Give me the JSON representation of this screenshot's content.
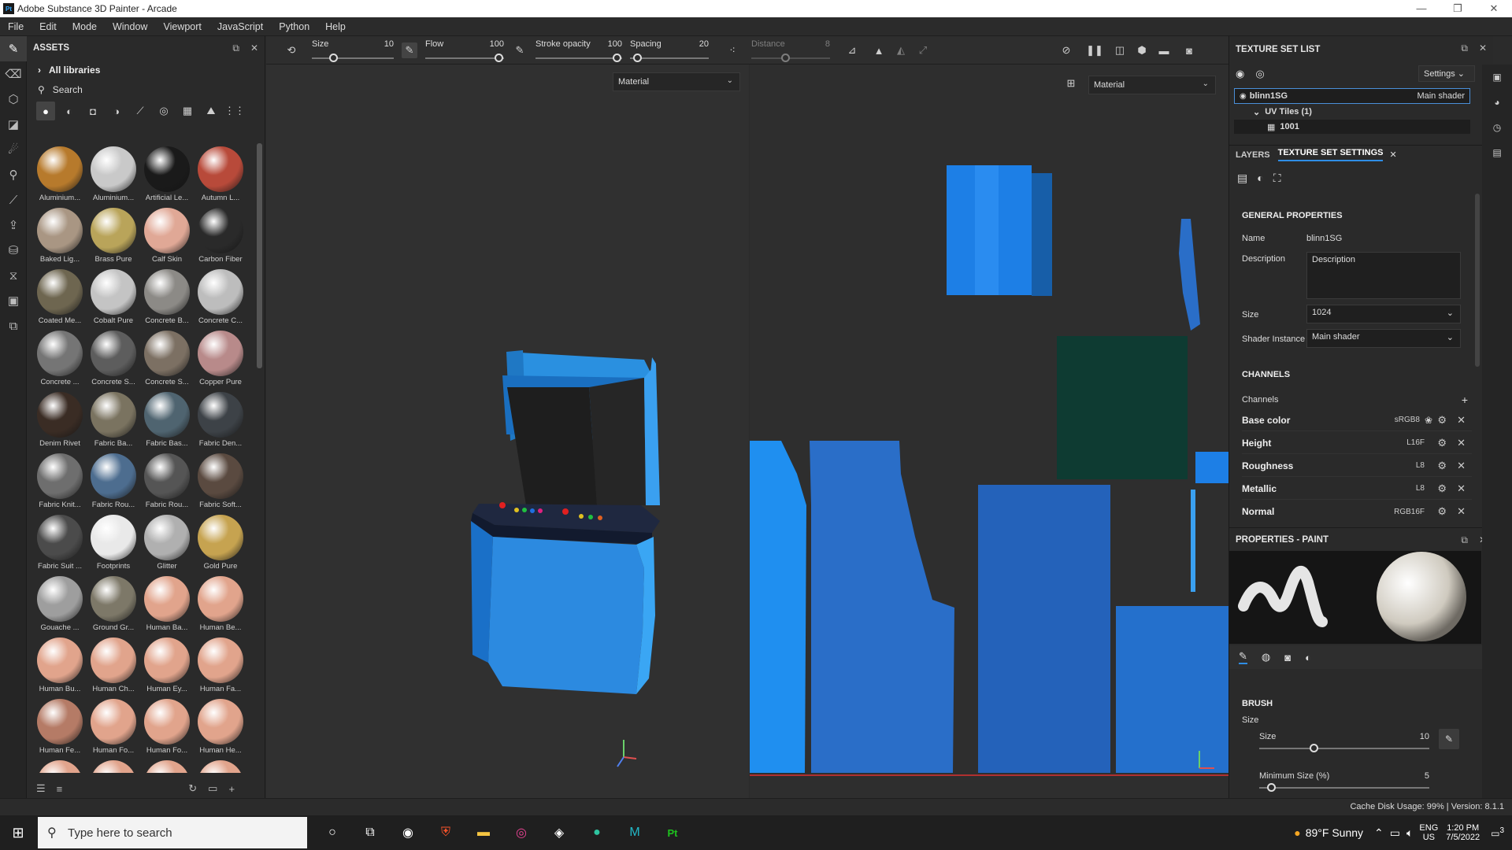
{
  "window": {
    "title": "Adobe Substance 3D Painter - Arcade",
    "app_badge": "Pt"
  },
  "menu": [
    "File",
    "Edit",
    "Mode",
    "Window",
    "Viewport",
    "JavaScript",
    "Python",
    "Help"
  ],
  "assets": {
    "title": "ASSETS",
    "breadcrumb": "All libraries",
    "search_placeholder": "Search",
    "materials": [
      {
        "label": "Aluminium...",
        "color": "#b77a2c"
      },
      {
        "label": "Aluminium...",
        "color": "#c9c9c9"
      },
      {
        "label": "Artificial Le...",
        "color": "#1a1a1a"
      },
      {
        "label": "Autumn L...",
        "color": "#b84a3a"
      },
      {
        "label": "Baked Lig...",
        "color": "#a99683"
      },
      {
        "label": "Brass Pure",
        "color": "#b9a45a"
      },
      {
        "label": "Calf Skin",
        "color": "#e0a896"
      },
      {
        "label": "Carbon Fiber",
        "color": "#2a2a2a"
      },
      {
        "label": "Coated Me...",
        "color": "#6e6650"
      },
      {
        "label": "Cobalt Pure",
        "color": "#c4c4c4"
      },
      {
        "label": "Concrete B...",
        "color": "#8c8a86"
      },
      {
        "label": "Concrete C...",
        "color": "#bdbdbd"
      },
      {
        "label": "Concrete ...",
        "color": "#757575"
      },
      {
        "label": "Concrete S...",
        "color": "#5d5d5d"
      },
      {
        "label": "Concrete S...",
        "color": "#7c7063"
      },
      {
        "label": "Copper Pure",
        "color": "#b88a8a"
      },
      {
        "label": "Denim Rivet",
        "color": "#3a2c24"
      },
      {
        "label": "Fabric Ba...",
        "color": "#7a7360"
      },
      {
        "label": "Fabric Bas...",
        "color": "#4f6470"
      },
      {
        "label": "Fabric Den...",
        "color": "#3d4247"
      },
      {
        "label": "Fabric Knit...",
        "color": "#6e6e6e"
      },
      {
        "label": "Fabric Rou...",
        "color": "#4d6d8f"
      },
      {
        "label": "Fabric Rou...",
        "color": "#555555"
      },
      {
        "label": "Fabric Soft...",
        "color": "#5a4a40"
      },
      {
        "label": "Fabric Suit ...",
        "color": "#4b4b4b"
      },
      {
        "label": "Footprints",
        "color": "#e9e9e9"
      },
      {
        "label": "Glitter",
        "color": "#b0b0b0"
      },
      {
        "label": "Gold Pure",
        "color": "#c6a350"
      },
      {
        "label": "Gouache ...",
        "color": "#9e9e9e"
      },
      {
        "label": "Ground Gr...",
        "color": "#7d7868"
      },
      {
        "label": "Human Ba...",
        "color": "#e1a48c"
      },
      {
        "label": "Human Be...",
        "color": "#e1a48c"
      },
      {
        "label": "Human Bu...",
        "color": "#e1a48c"
      },
      {
        "label": "Human Ch...",
        "color": "#e1a48c"
      },
      {
        "label": "Human Ey...",
        "color": "#e1a48c"
      },
      {
        "label": "Human Fa...",
        "color": "#e1a48c"
      },
      {
        "label": "Human Fe...",
        "color": "#b57b66"
      },
      {
        "label": "Human Fo...",
        "color": "#e1a48c"
      },
      {
        "label": "Human Fo...",
        "color": "#e1a48c"
      },
      {
        "label": "Human He...",
        "color": "#e1a48c"
      },
      {
        "label": "",
        "color": "#e1a48c"
      },
      {
        "label": "",
        "color": "#e1a48c"
      },
      {
        "label": "",
        "color": "#e1a48c"
      },
      {
        "label": "",
        "color": "#e1a48c"
      }
    ]
  },
  "toolbar": {
    "size_label": "Size",
    "size_value": "10",
    "flow_label": "Flow",
    "flow_value": "100",
    "opacity_label": "Stroke opacity",
    "opacity_value": "100",
    "spacing_label": "Spacing",
    "spacing_value": "20",
    "distance_label": "Distance",
    "distance_value": "8"
  },
  "viewport3d": {
    "mode": "Material"
  },
  "viewport2d": {
    "mode": "Material"
  },
  "texture_set_list": {
    "title": "TEXTURE SET LIST",
    "settings_label": "Settings",
    "set_name": "blinn1SG",
    "shader": "Main shader",
    "uv_tiles": "UV Tiles (1)",
    "tile": "1001"
  },
  "tabs": {
    "layers": "LAYERS",
    "tss": "TEXTURE SET SETTINGS"
  },
  "general": {
    "heading": "GENERAL PROPERTIES",
    "name_label": "Name",
    "name_value": "blinn1SG",
    "desc_label": "Description",
    "desc_value": "Description",
    "size_label": "Size",
    "size_value": "1024",
    "shader_label": "Shader Instance",
    "shader_value": "Main shader"
  },
  "channels": {
    "heading": "CHANNELS",
    "label": "Channels",
    "items": [
      {
        "name": "Base color",
        "format": "sRGB8"
      },
      {
        "name": "Height",
        "format": "L16F"
      },
      {
        "name": "Roughness",
        "format": "L8"
      },
      {
        "name": "Metallic",
        "format": "L8"
      },
      {
        "name": "Normal",
        "format": "RGB16F"
      }
    ]
  },
  "properties": {
    "title": "PROPERTIES - PAINT",
    "brush_heading": "BRUSH",
    "size_group": "Size",
    "size_label": "Size",
    "size_value": "10",
    "min_size_label": "Minimum Size (%)",
    "min_size_value": "5"
  },
  "status": {
    "cache": "Cache Disk Usage:",
    "cache_value": "99%",
    "version": "Version: 8.1.1"
  },
  "taskbar": {
    "search_placeholder": "Type here to search",
    "weather": "89°F  Sunny",
    "lang1": "ENG",
    "lang2": "US",
    "time": "1:20 PM",
    "date": "7/5/2022",
    "notif": "3"
  }
}
